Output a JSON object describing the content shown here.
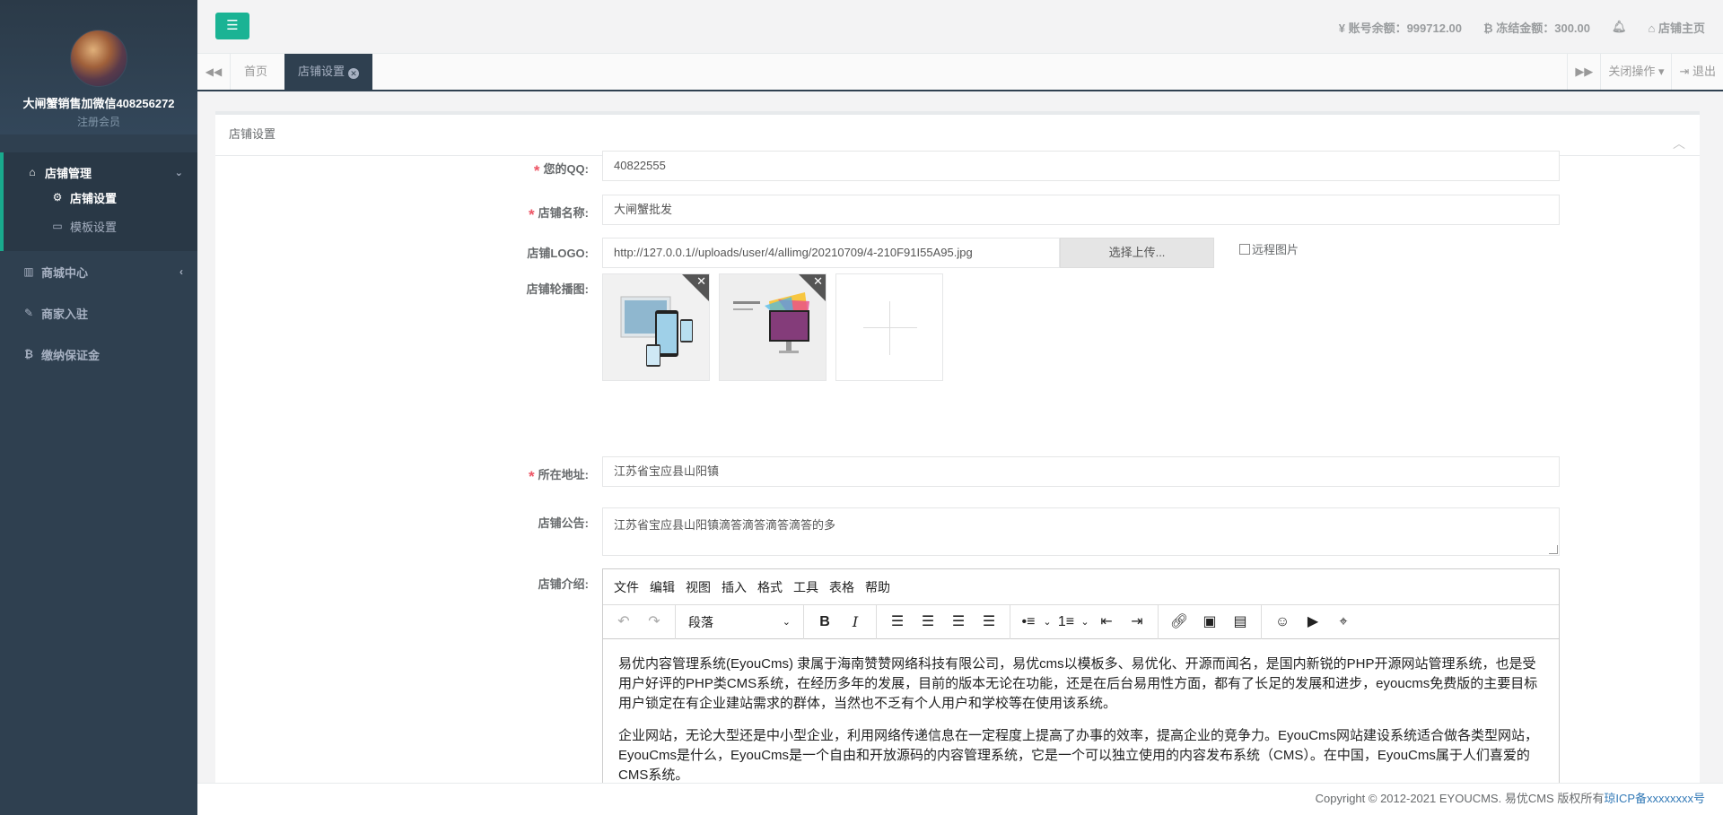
{
  "sidebar": {
    "profile_name": "大闸蟹销售加微信408256272",
    "profile_role": "注册会员",
    "group_title": "店铺管理",
    "sub_items": [
      {
        "label": "店铺设置"
      },
      {
        "label": "模板设置"
      }
    ],
    "items": [
      {
        "label": "商城中心"
      },
      {
        "label": "商家入驻"
      },
      {
        "label": "缴纳保证金"
      }
    ]
  },
  "topbar": {
    "balance_label": "账号余额：999712.00",
    "frozen_label": "冻结金额：300.00",
    "home_label": "店铺主页"
  },
  "tabs": {
    "home": "首页",
    "active": "店铺设置",
    "close_ops": "关闭操作",
    "logout": "退出"
  },
  "panel": {
    "title": "店铺设置"
  },
  "form": {
    "qq_label": "您的QQ:",
    "qq_value": "40822555",
    "name_label": "店铺名称:",
    "name_value": "大闸蟹批发",
    "logo_label": "店铺LOGO:",
    "logo_value": "http://127.0.0.1//uploads/user/4/allimg/20210709/4-210F91I55A95.jpg",
    "upload_label": "选择上传...",
    "remote_label": "远程图片",
    "banner_label": "店铺轮播图:",
    "address_label": "所在地址:",
    "address_value": "江苏省宝应县山阳镇",
    "notice_label": "店铺公告:",
    "notice_value": "江苏省宝应县山阳镇滴答滴答滴答滴答的多",
    "intro_label": "店铺介绍:"
  },
  "editor": {
    "menu": [
      "文件",
      "编辑",
      "视图",
      "插入",
      "格式",
      "工具",
      "表格",
      "帮助"
    ],
    "format_value": "段落",
    "paragraphs": [
      "易优内容管理系统(EyouCms) 隶属于海南赞赞网络科技有限公司，易优cms以模板多、易优化、开源而闻名，是国内新锐的PHP开源网站管理系统，也是受用户好评的PHP类CMS系统，在经历多年的发展，目前的版本无论在功能，还是在后台易用性方面，都有了长足的发展和进步，eyoucms免费版的主要目标用户锁定在有企业建站需求的群体，当然也不乏有个人用户和学校等在使用该系统。",
      "企业网站，无论大型还是中小型企业，利用网络传递信息在一定程度上提高了办事的效率，提高企业的竞争力。EyouCms网站建设系统适合做各类型网站，EyouCms是什么，EyouCms是一个自由和开放源码的内容管理系统，它是一个可以独立使用的内容发布系统（CMS）。在中国，EyouCms属于人们喜爱的CMS系统。"
    ]
  },
  "footer": {
    "copyright": "Copyright © 2012-2021 EYOUCMS. 易优CMS 版权所有",
    "icp": "琼ICP备xxxxxxxx号"
  },
  "colors": {
    "sidebar": "#2f4050",
    "accent": "#1ab394",
    "required": "#ed5565"
  }
}
